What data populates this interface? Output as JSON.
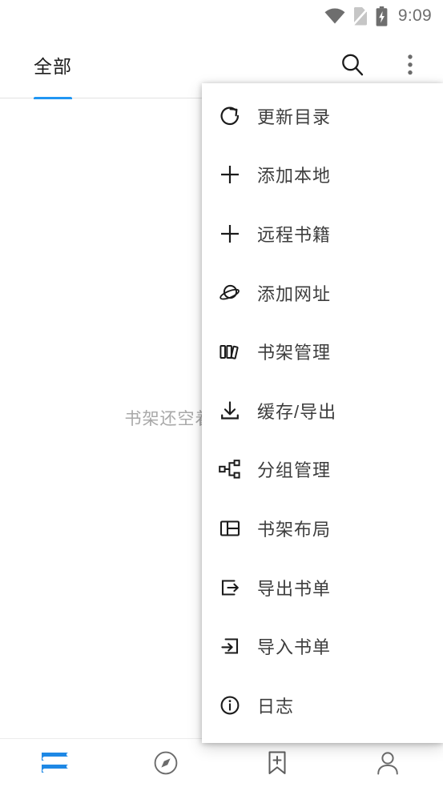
{
  "statusbar": {
    "time": "9:09",
    "icons": [
      "wifi-icon",
      "no-sim-icon",
      "battery-charging-icon"
    ]
  },
  "toolbar": {
    "tabs": [
      {
        "label": "全部",
        "selected": true
      }
    ],
    "accent_color": "#2196F3",
    "actions": [
      {
        "name": "search-icon",
        "label": "搜索"
      },
      {
        "name": "more-vert-icon",
        "label": "更多"
      }
    ]
  },
  "content": {
    "empty_text": "书架还空着，先去搜索吧"
  },
  "menu": {
    "items": [
      {
        "icon": "refresh-icon",
        "label": "更新目录"
      },
      {
        "icon": "plus-icon",
        "label": "添加本地"
      },
      {
        "icon": "plus-icon",
        "label": "远程书籍"
      },
      {
        "icon": "planet-icon",
        "label": "添加网址"
      },
      {
        "icon": "books-icon",
        "label": "书架管理"
      },
      {
        "icon": "download-icon",
        "label": "缓存/导出"
      },
      {
        "icon": "sitemap-icon",
        "label": "分组管理"
      },
      {
        "icon": "layout-icon",
        "label": "书架布局"
      },
      {
        "icon": "export-icon",
        "label": "导出书单"
      },
      {
        "icon": "import-icon",
        "label": "导入书单"
      },
      {
        "icon": "info-icon",
        "label": "日志"
      }
    ]
  },
  "bottomnav": {
    "items": [
      {
        "icon": "bookshelf-icon",
        "label": "书架",
        "active": true
      },
      {
        "icon": "compass-icon",
        "label": "发现",
        "active": false
      },
      {
        "icon": "bookmark-plus-icon",
        "label": "书单",
        "active": false
      },
      {
        "icon": "person-icon",
        "label": "我的",
        "active": false
      }
    ],
    "active_color": "#1E88E5",
    "inactive_color": "#6b6b6b"
  }
}
